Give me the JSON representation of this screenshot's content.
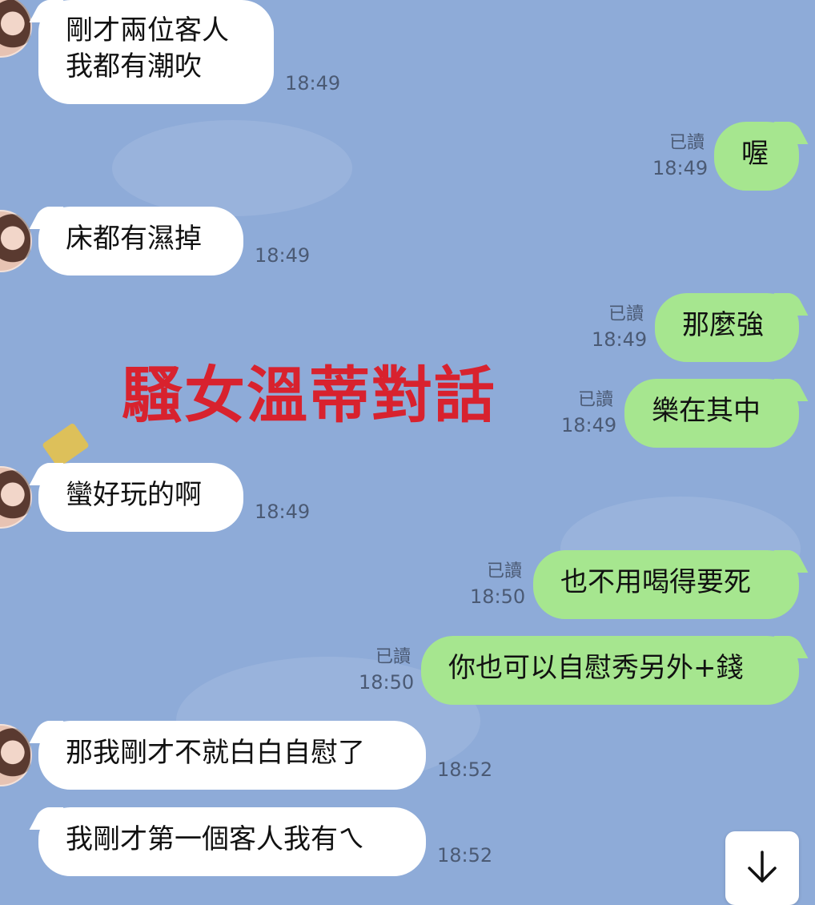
{
  "read_label": "已讀",
  "watermark": "騷女溫蒂對話",
  "messages": [
    {
      "lines": [
        "剛才兩位客人",
        "我都有潮吹"
      ],
      "time": "18:49"
    },
    {
      "text": "喔",
      "time": "18:49"
    },
    {
      "text": "床都有濕掉",
      "time": "18:49"
    },
    {
      "text": "那麼強",
      "time": "18:49"
    },
    {
      "text": "樂在其中",
      "time": "18:49"
    },
    {
      "text": "蠻好玩的啊",
      "time": "18:49"
    },
    {
      "text": "也不用喝得要死",
      "time": "18:50"
    },
    {
      "text": "你也可以自慰秀另外+錢",
      "time": "18:50"
    },
    {
      "text": "那我剛才不就白白自慰了",
      "time": "18:52"
    },
    {
      "text": "我剛才第一個客人我有ㄟ",
      "time": "18:52"
    }
  ],
  "icons": {
    "scroll_down": "arrow-down-icon",
    "avatar": "contact-avatar"
  }
}
